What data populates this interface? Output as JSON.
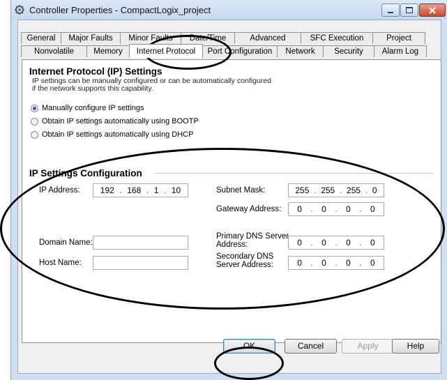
{
  "window": {
    "title": "Controller Properties - CompactLogix_project",
    "icon": "gear-icon",
    "buttons": [
      "minimize-icon",
      "maximize-icon",
      "close-icon"
    ]
  },
  "tabs": {
    "row1": [
      "General",
      "Major Faults",
      "Minor Faults",
      "Date/Time",
      "Advanced",
      "SFC Execution",
      "Project"
    ],
    "row2": [
      "Nonvolatile Memory",
      "Memory",
      "Internet Protocol",
      "Port Configuration",
      "Network",
      "Security",
      "Alarm Log"
    ],
    "active": "Internet Protocol"
  },
  "ip_settings": {
    "heading": "Internet Protocol (IP) Settings",
    "description_line1": "IP settings can be manually configured or can be automatically configured",
    "description_line2": "if the network supports this capability.",
    "options": [
      {
        "label": "Manually configure IP settings",
        "checked": true
      },
      {
        "label": "Obtain IP settings automatically using BOOTP",
        "checked": false
      },
      {
        "label": "Obtain IP settings automatically using DHCP",
        "checked": false
      }
    ]
  },
  "config": {
    "heading": "IP Settings Configuration",
    "ip_address": {
      "label": "IP Address:",
      "octets": [
        "192",
        "168",
        "1",
        "10"
      ]
    },
    "subnet_mask": {
      "label": "Subnet Mask:",
      "octets": [
        "255",
        "255",
        "255",
        "0"
      ]
    },
    "gateway": {
      "label": "Gateway Address:",
      "octets": [
        "0",
        "0",
        "0",
        "0"
      ]
    },
    "primary_dns": {
      "label_line1": "Primary DNS Server",
      "label_line2": "Address:",
      "octets": [
        "0",
        "0",
        "0",
        "0"
      ]
    },
    "secondary_dns": {
      "label_line1": "Secondary DNS",
      "label_line2": "Server Address:",
      "octets": [
        "0",
        "0",
        "0",
        "0"
      ]
    },
    "domain_name": {
      "label": "Domain Name:",
      "value": ""
    },
    "host_name": {
      "label": "Host Name:",
      "value": ""
    }
  },
  "footer": {
    "ok": "OK",
    "cancel": "Cancel",
    "apply": "Apply",
    "help": "Help"
  }
}
